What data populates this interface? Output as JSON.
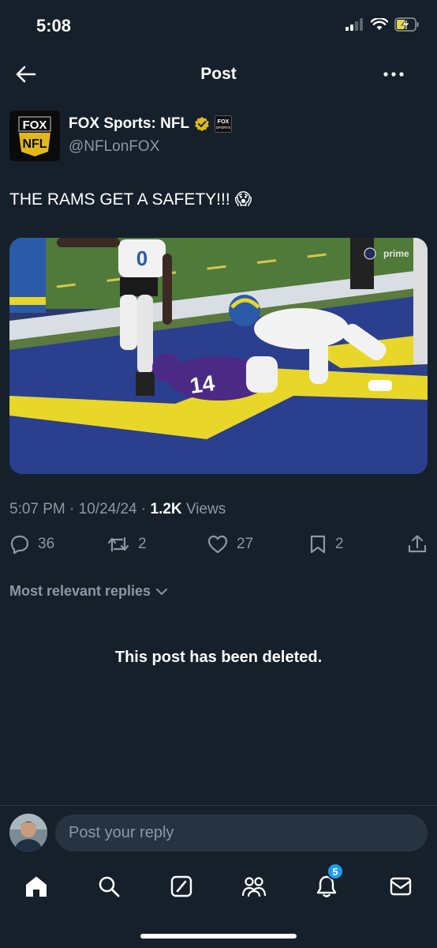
{
  "status_bar": {
    "time": "5:08"
  },
  "header": {
    "title": "Post"
  },
  "author": {
    "name": "FOX Sports: NFL",
    "handle": "@NFLonFOX",
    "avatar_top": "FOX",
    "avatar_bottom": "NFL",
    "affiliate_badge": "FOX SPORTS"
  },
  "post": {
    "text": "THE RAMS GET A SAFETY!!! 😱",
    "media_overlay": {
      "broadcaster_mark": "prime"
    },
    "time": "5:07 PM",
    "date": "10/24/24",
    "views_count": "1.2K",
    "views_label": "Views"
  },
  "actions": {
    "replies": "36",
    "reposts": "2",
    "likes": "27",
    "bookmarks": "2"
  },
  "replies_filter": "Most relevant replies",
  "deleted_message": "This post has been deleted.",
  "reply_bar": {
    "placeholder": "Post your reply"
  },
  "tabbar": {
    "notifications_badge": "5"
  },
  "colors": {
    "background": "#15202b",
    "muted": "#8b98a5",
    "accent": "#1d9bf0",
    "verified_gold": "#e2b719"
  }
}
